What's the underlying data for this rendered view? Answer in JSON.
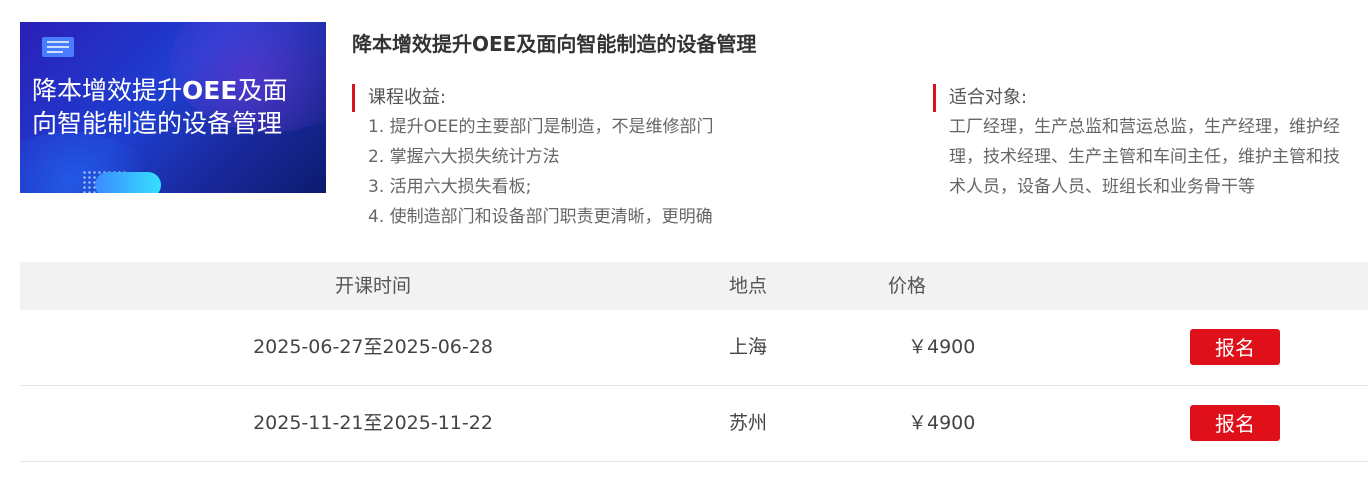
{
  "banner": {
    "line1_pre": "降本增效提升",
    "line1_bold": "OEE",
    "line1_post": "及面",
    "line2": "向智能制造的设备管理"
  },
  "course": {
    "title": "降本增效提升OEE及面向智能制造的设备管理"
  },
  "benefits": {
    "heading": "课程收益:",
    "items": [
      "1. 提升OEE的主要部门是制造，不是维修部门",
      "2. 掌握六大损失统计方法",
      "3. 活用六大损失看板;",
      "4. 使制造部门和设备部门职责更清晰，更明确"
    ]
  },
  "audience": {
    "heading": "适合对象:",
    "text": "工厂经理，生产总监和营运总监，生产经理，维护经理，技术经理、生产主管和车间主任，维护主管和技术人员，设备人员、班组长和业务骨干等"
  },
  "schedule": {
    "headers": {
      "time": "开课时间",
      "place": "地点",
      "price": "价格"
    },
    "rows": [
      {
        "time": "2025-06-27至2025-06-28",
        "place": "上海",
        "price": "￥4900",
        "button": "报名"
      },
      {
        "time": "2025-11-21至2025-11-22",
        "place": "苏州",
        "price": "￥4900",
        "button": "报名"
      }
    ]
  },
  "colors": {
    "accent": "#e0101b",
    "header_bg": "#f2f2f2",
    "banner_blue": "#1e3fd0"
  }
}
